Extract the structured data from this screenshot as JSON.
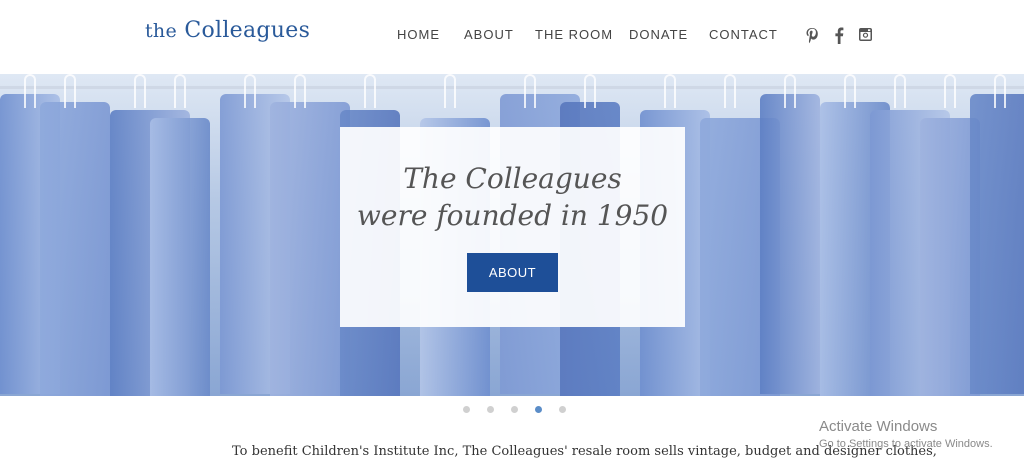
{
  "header": {
    "logo_the": "the",
    "logo_name": "Colleagues",
    "nav": {
      "home": "HOME",
      "about": "ABOUT",
      "room": "THE ROOM",
      "donate": "DONATE",
      "contact": "CONTACT"
    },
    "social": {
      "pinterest": "pinterest-icon",
      "facebook": "facebook-icon",
      "instagram": "instagram-icon"
    }
  },
  "hero": {
    "title_line1": "The Colleagues",
    "title_line2": "were founded in 1950",
    "button_label": "ABOUT",
    "slides_total": 5,
    "active_slide": 4,
    "colors": {
      "button": "#1e4f98",
      "active_dot": "#5b8dc8"
    }
  },
  "intro": {
    "text": "To benefit Children's Institute Inc, The Colleagues' resale room sells vintage, budget and designer clothes,"
  },
  "watermark": {
    "title": "Activate Windows",
    "subtitle": "Go to Settings to activate Windows."
  }
}
